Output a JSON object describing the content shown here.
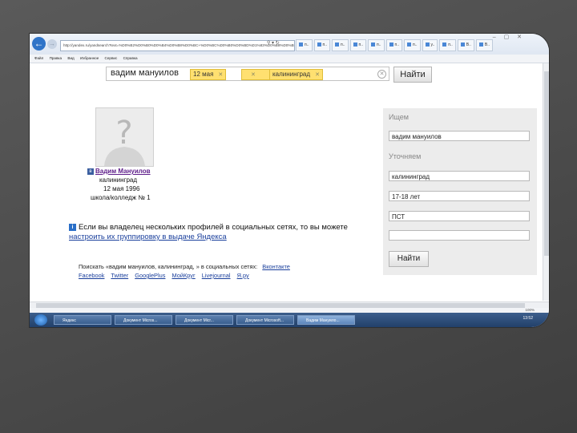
{
  "browser": {
    "address": "http://yandex.ru/yandsearch?text=%D0%B2%D0%B0%D0%B4%D0%B8%D0%BC+%D0%BC%D0%B0%D0%BD%D1%83%D0%B8%D0%BB",
    "tabs": [
      "п..",
      "п..",
      "п..",
      "п..",
      "п..",
      "п..",
      "п..",
      "у..",
      "п..",
      "В..",
      "В.."
    ],
    "menu": [
      "Файл",
      "Правка",
      "Вид",
      "Избранное",
      "Сервис",
      "Справка"
    ],
    "zoom": "100%"
  },
  "search": {
    "query": "вадим мануилов",
    "chips": [
      "12 мая",
      "",
      "калининград"
    ],
    "find_label": "Найти"
  },
  "profile": {
    "name": "Вадим Мануилов",
    "city": "калининград",
    "birth": "12 мая 1996",
    "school": "школа/колледж № 1"
  },
  "info": {
    "text_before": "Если вы владелец нескольких профилей в социальных сетях, то вы можете ",
    "link": "настроить их группировку в выдаче Яндекса"
  },
  "networks": {
    "prefix": "Поискать «вадим мануилов, калининград, » в социальных сетях:",
    "links": [
      "Вконтакте",
      "Facebook",
      "Twitter",
      "GooglePlus",
      "МойКруг",
      "Livejournal",
      "Я.ру"
    ]
  },
  "panel": {
    "search_head": "Ищем",
    "search_value": "вадим мануилов",
    "refine_head": "Уточняем",
    "fields": [
      "калининград",
      "17-18 лет",
      "ПСТ",
      ""
    ],
    "find_label": "Найти"
  },
  "taskbar": {
    "tasks": [
      "Яндекс",
      "Документ Micros...",
      "Документ Micr...",
      "Документ Microsoft...",
      "Вадим Мануило..."
    ],
    "clock": "13:52"
  },
  "colors": {
    "chip": "#ffe070",
    "link": "#1a3f9c",
    "visited": "#5e1d8a",
    "panel": "#ececec"
  }
}
